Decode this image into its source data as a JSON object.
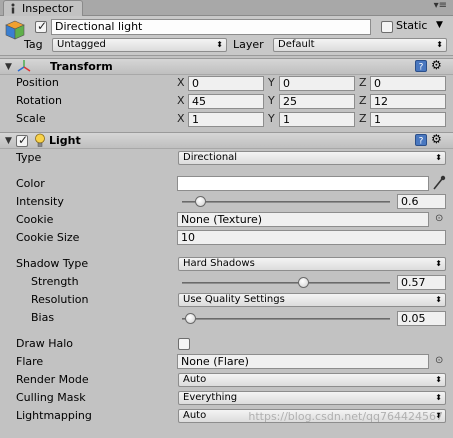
{
  "tab": {
    "label": "Inspector"
  },
  "header": {
    "active_checked": true,
    "object_name": "Directional light",
    "static_label": "Static",
    "static_checked": false,
    "tag_label": "Tag",
    "tag_value": "Untagged",
    "layer_label": "Layer",
    "layer_value": "Default"
  },
  "transform": {
    "title": "Transform",
    "rows": [
      {
        "label": "Position",
        "x": "0",
        "y": "0",
        "z": "0"
      },
      {
        "label": "Rotation",
        "x": "45",
        "y": "25",
        "z": "12"
      },
      {
        "label": "Scale",
        "x": "1",
        "y": "1",
        "z": "1"
      }
    ],
    "axis_x": "X",
    "axis_y": "Y",
    "axis_z": "Z"
  },
  "light": {
    "title": "Light",
    "enabled": true,
    "type_label": "Type",
    "type_value": "Directional",
    "color_label": "Color",
    "color_value": "#ffffff",
    "intensity_label": "Intensity",
    "intensity_value": "0.6",
    "intensity_fraction": 0.075,
    "cookie_label": "Cookie",
    "cookie_value": "None (Texture)",
    "cookie_size_label": "Cookie Size",
    "cookie_size_value": "10",
    "shadow_type_label": "Shadow Type",
    "shadow_type_value": "Hard Shadows",
    "strength_label": "Strength",
    "strength_value": "0.57",
    "strength_fraction": 0.57,
    "resolution_label": "Resolution",
    "resolution_value": "Use Quality Settings",
    "bias_label": "Bias",
    "bias_value": "0.05",
    "bias_fraction": 0.025,
    "draw_halo_label": "Draw Halo",
    "draw_halo_checked": false,
    "flare_label": "Flare",
    "flare_value": "None (Flare)",
    "render_mode_label": "Render Mode",
    "render_mode_value": "Auto",
    "culling_mask_label": "Culling Mask",
    "culling_mask_value": "Everything",
    "lightmapping_label": "Lightmapping",
    "lightmapping_value": "Auto"
  },
  "watermark": "https://blog.csdn.net/qq764424567",
  "colors": {
    "panel_bg": "#c2c2c2",
    "section_bg": "#cbcbcb"
  }
}
